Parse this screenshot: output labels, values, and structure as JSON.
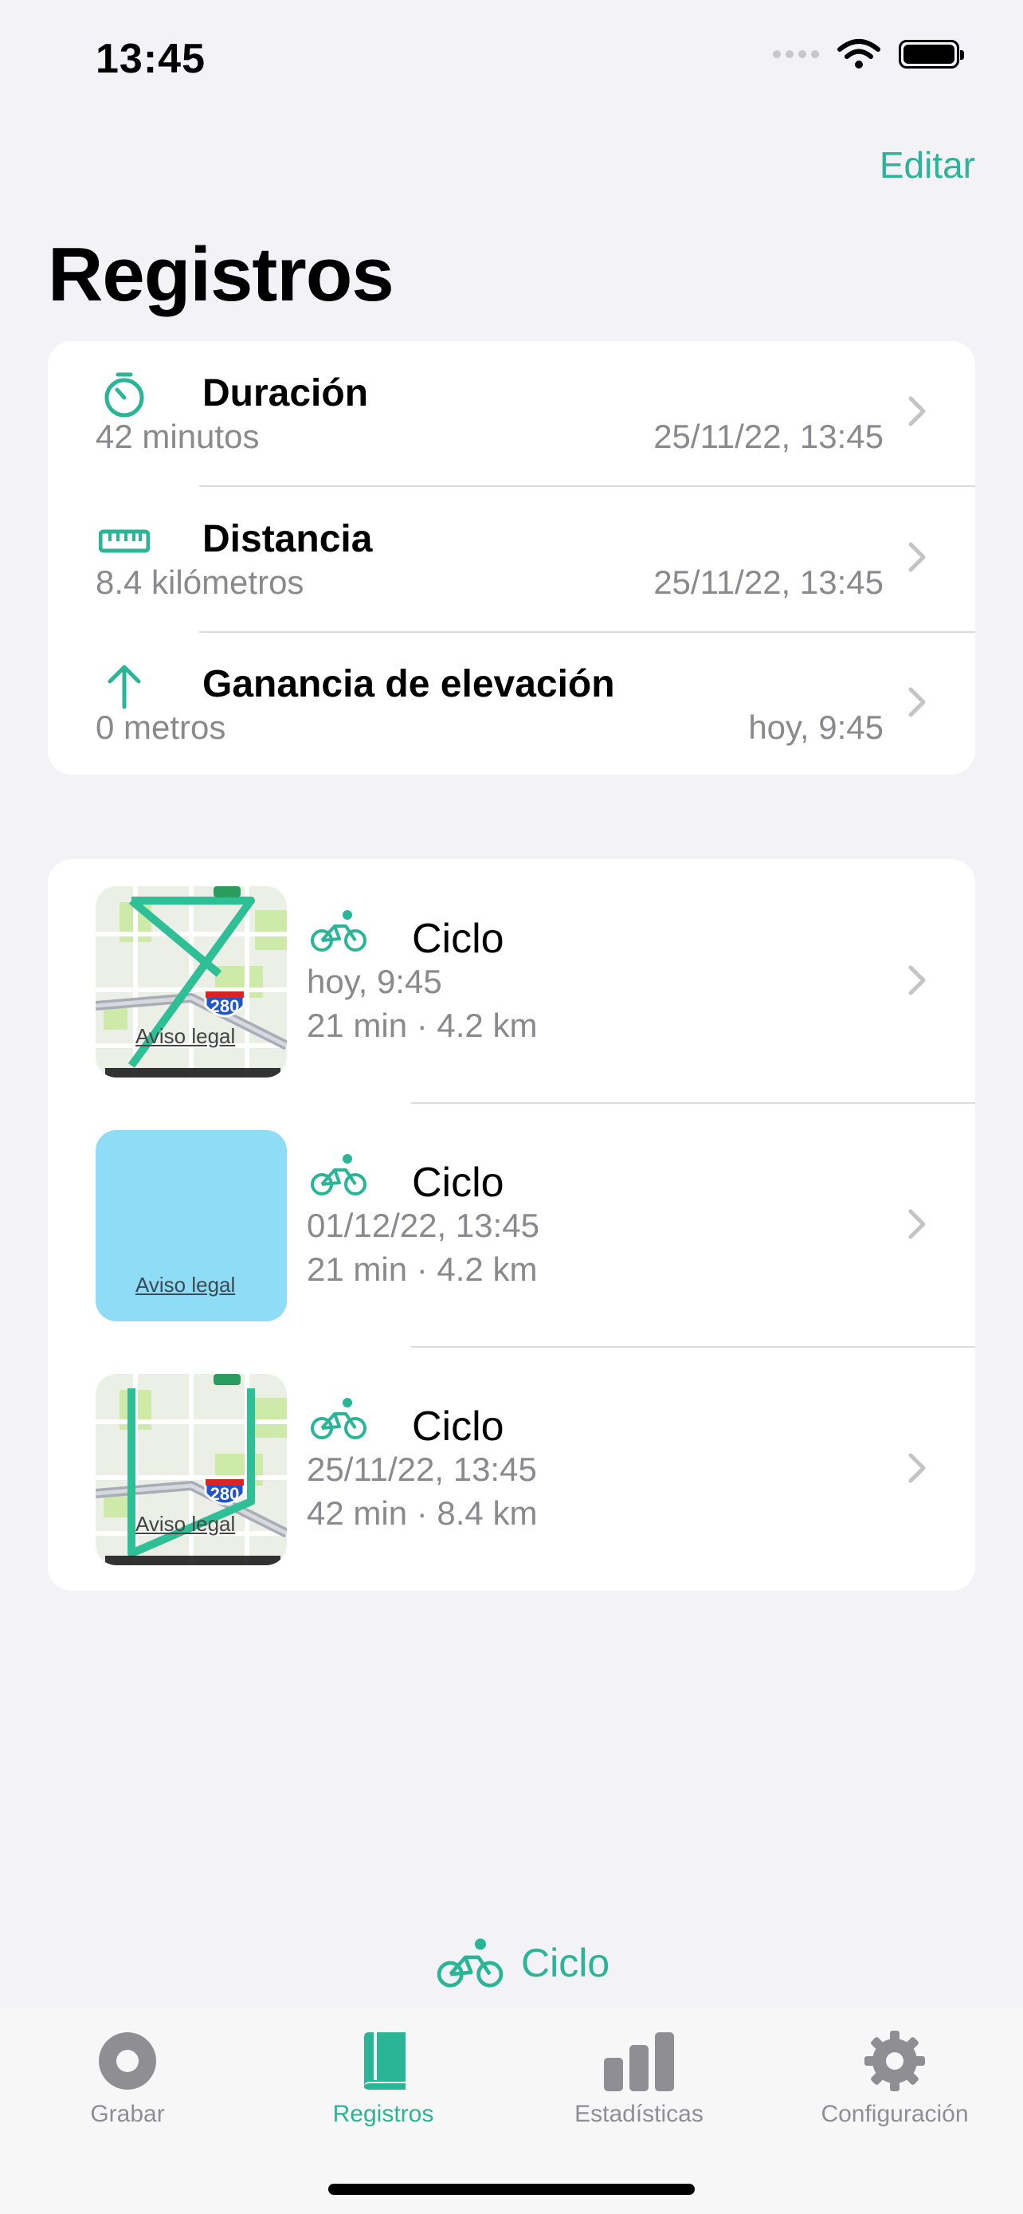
{
  "status": {
    "time": "13:45"
  },
  "nav": {
    "edit_label": "Editar",
    "title": "Registros"
  },
  "summary": [
    {
      "icon": "timer-icon",
      "title": "Duración",
      "value": "42 minutos",
      "date": "25/11/22, 13:45"
    },
    {
      "icon": "ruler-icon",
      "title": "Distancia",
      "value": "8.4 kilómetros",
      "date": "25/11/22, 13:45"
    },
    {
      "icon": "arrow-up-icon",
      "title": "Ganancia de elevación",
      "value": "0 metros",
      "date": "hoy, 9:45"
    }
  ],
  "records": [
    {
      "icon": "bicycle-icon",
      "title": "Ciclo",
      "date": "hoy, 9:45",
      "detail": "21 min · 4.2 km",
      "map_legal": "Aviso legal",
      "highway": "280"
    },
    {
      "icon": "bicycle-icon",
      "title": "Ciclo",
      "date": "01/12/22, 13:45",
      "detail": "21 min · 4.2 km",
      "map_legal": "Aviso legal"
    },
    {
      "icon": "bicycle-icon",
      "title": "Ciclo",
      "date": "25/11/22, 13:45",
      "detail": "42 min · 8.4 km",
      "map_legal": "Aviso legal",
      "highway": "280"
    }
  ],
  "activity": {
    "icon": "bicycle-icon",
    "label": "Ciclo"
  },
  "tabs": [
    {
      "icon": "record-icon",
      "label": "Grabar"
    },
    {
      "icon": "book-icon",
      "label": "Registros",
      "active": true
    },
    {
      "icon": "bar-chart-icon",
      "label": "Estadísticas"
    },
    {
      "icon": "gear-icon",
      "label": "Configuración"
    }
  ],
  "colors": {
    "accent": "#2ab596",
    "secondary_text": "#8a8a8e",
    "background": "#f2f2f7"
  }
}
